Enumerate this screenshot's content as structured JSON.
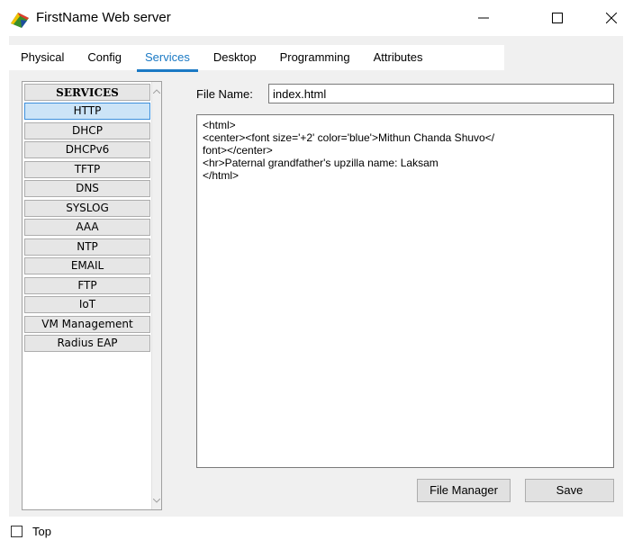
{
  "window": {
    "title": "FirstName Web server",
    "icon": "packet-tracer-server-icon"
  },
  "tabs": [
    {
      "label": "Physical",
      "active": false
    },
    {
      "label": "Config",
      "active": false
    },
    {
      "label": "Services",
      "active": true
    },
    {
      "label": "Desktop",
      "active": false
    },
    {
      "label": "Programming",
      "active": false
    },
    {
      "label": "Attributes",
      "active": false
    }
  ],
  "services": {
    "header": "SERVICES",
    "items": [
      "HTTP",
      "DHCP",
      "DHCPv6",
      "TFTP",
      "DNS",
      "SYSLOG",
      "AAA",
      "NTP",
      "EMAIL",
      "FTP",
      "IoT",
      "VM Management",
      "Radius EAP"
    ],
    "selected": "HTTP"
  },
  "file": {
    "label": "File Name:",
    "value": "index.html",
    "content": "<html>\n<center><font size='+2' color='blue'>Mithun Chanda Shuvo</\nfont></center>\n<hr>Paternal grandfather's upzilla name: Laksam\n</html>"
  },
  "buttons": {
    "file_manager": "File Manager",
    "save": "Save"
  },
  "footer": {
    "top_label": "Top",
    "top_checked": false
  },
  "colors": {
    "accent": "#1a79c4",
    "selected_bg": "#cce4f7",
    "panel_bg": "#f0f0f0"
  }
}
